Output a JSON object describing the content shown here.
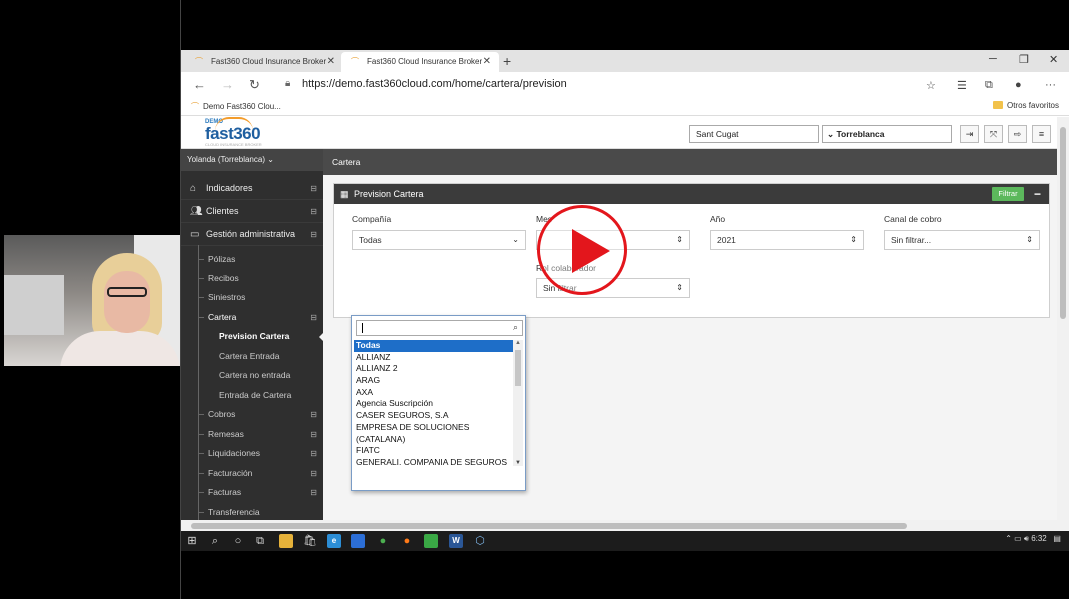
{
  "browser": {
    "tabs": [
      {
        "label": "Fast360 Cloud Insurance Broker",
        "active": false
      },
      {
        "label": "Fast360 Cloud Insurance Broker",
        "active": true
      }
    ],
    "url": "https://demo.fast360cloud.com/home/cartera/prevision",
    "favorites": {
      "left": "Demo Fast360 Clou...",
      "right": "Otros favoritos"
    }
  },
  "app": {
    "logo": {
      "demo": "DEMO",
      "brand": "fast360",
      "tagline": "CLOUD INSURANCE BROKER"
    },
    "header": {
      "office": "Sant Cugat",
      "user_select": "Torreblanca"
    },
    "sidebar": {
      "user": "Yolanda (Torreblanca)",
      "main": [
        {
          "label": "Indicadores",
          "icon": "home-icon"
        },
        {
          "label": "Clientes",
          "icon": "users-icon"
        },
        {
          "label": "Gestión administrativa",
          "icon": "monitor-icon"
        }
      ],
      "sub": [
        {
          "label": "Pólizas"
        },
        {
          "label": "Recibos"
        },
        {
          "label": "Siniestros"
        },
        {
          "label": "Cartera"
        },
        {
          "label": "Cobros"
        },
        {
          "label": "Remesas"
        },
        {
          "label": "Liquidaciones"
        },
        {
          "label": "Facturación"
        },
        {
          "label": "Facturas"
        },
        {
          "label": "Transferencia"
        }
      ],
      "cartera_items": [
        {
          "label": "Prevision Cartera",
          "active": true
        },
        {
          "label": "Cartera Entrada"
        },
        {
          "label": "Cartera no entrada"
        },
        {
          "label": "Entrada de Cartera"
        }
      ]
    },
    "breadcrumb": "Cartera",
    "panel": {
      "title": "Prevision Cartera",
      "filter_button": "Filtrar",
      "collapse": "−",
      "fields": {
        "compania": {
          "label": "Compañía",
          "value": "Todas"
        },
        "mes": {
          "label": "Mes",
          "value": ""
        },
        "anio": {
          "label": "Año",
          "value": "2021"
        },
        "canal": {
          "label": "Canal de cobro",
          "value": "Sin filtrar..."
        },
        "colaborador": {
          "label": "Rol colaborador",
          "value": "Sin filtrar"
        }
      }
    },
    "dropdown": {
      "search_value": "",
      "options": [
        "Todas",
        "ALLIANZ",
        "ALLIANZ 2",
        "ARAG",
        "AXA",
        "Agencia Suscripción",
        "CASER SEGUROS, S.A",
        "EMPRESA DE SOLUCIONES",
        "(CATALANA)",
        "FIATC",
        "GENERALI, COMPANIA DE SEGUROS"
      ],
      "selected": "Todas"
    }
  },
  "taskbar": {
    "time": "6:32"
  }
}
